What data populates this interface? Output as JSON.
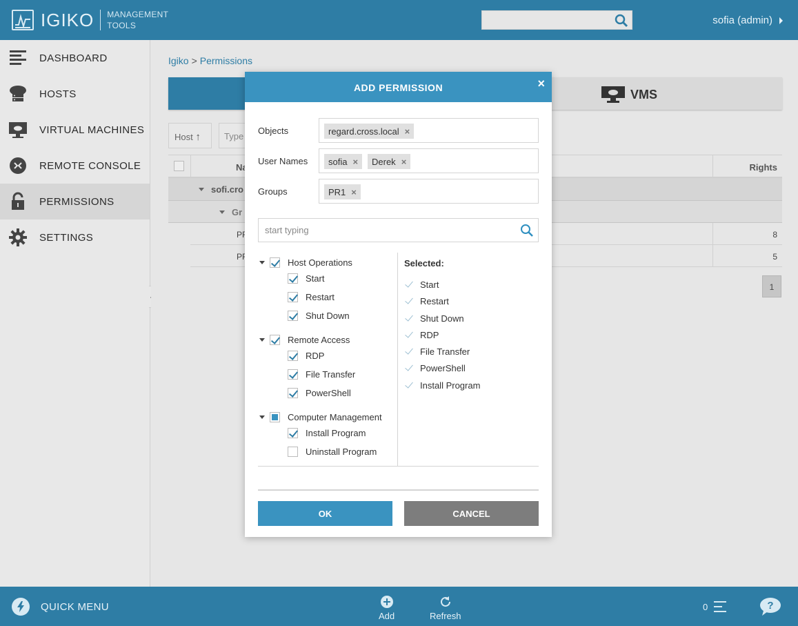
{
  "app": {
    "brand": "IGIKO",
    "subtitle_line1": "MANAGEMENT",
    "subtitle_line2": "TOOLS",
    "user": "sofia (admin)",
    "search_placeholder": ""
  },
  "sidebar": {
    "items": [
      {
        "label": "DASHBOARD",
        "icon": "dashboard-icon"
      },
      {
        "label": "HOSTS",
        "icon": "hosts-icon"
      },
      {
        "label": "VIRTUAL MACHINES",
        "icon": "vm-icon"
      },
      {
        "label": "REMOTE CONSOLE",
        "icon": "remote-console-icon"
      },
      {
        "label": "PERMISSIONS",
        "icon": "lock-icon",
        "active": true
      },
      {
        "label": "SETTINGS",
        "icon": "gear-icon"
      }
    ]
  },
  "main": {
    "breadcrumb": [
      "Igiko",
      "Permissions"
    ],
    "breadcrumb_sep": ">",
    "tabs": {
      "vms": "VMS"
    },
    "filters": {
      "host": "Host",
      "type": "Type"
    },
    "grid": {
      "col_name": "Na",
      "col_rights": "Rights",
      "group1": "sofi.cro",
      "group2": "Gr",
      "rows": [
        {
          "name": "PF",
          "rights": "8"
        },
        {
          "name": "PF",
          "rights": "5"
        }
      ]
    },
    "pager": "1"
  },
  "dialog": {
    "title": "ADD PERMISSION",
    "close": "×",
    "objects_label": "Objects",
    "objects": [
      "regard.cross.local"
    ],
    "usernames_label": "User Names",
    "usernames": [
      "sofia",
      "Derek"
    ],
    "groups_label": "Groups",
    "groups": [
      "PR1"
    ],
    "chip_remove": "×",
    "search_placeholder": "start typing",
    "tree": [
      {
        "label": "Host Operations",
        "state": "checked",
        "children": [
          {
            "label": "Start",
            "checked": true
          },
          {
            "label": "Restart",
            "checked": true
          },
          {
            "label": "Shut Down",
            "checked": true
          }
        ]
      },
      {
        "label": "Remote Access",
        "state": "checked",
        "children": [
          {
            "label": "RDP",
            "checked": true
          },
          {
            "label": "File Transfer",
            "checked": true
          },
          {
            "label": "PowerShell",
            "checked": true
          }
        ]
      },
      {
        "label": "Computer Management",
        "state": "partial",
        "children": [
          {
            "label": "Install Program",
            "checked": true
          },
          {
            "label": "Uninstall Program",
            "checked": false
          }
        ]
      }
    ],
    "selected_title": "Selected:",
    "selected": [
      "Start",
      "Restart",
      "Shut Down",
      "RDP",
      "File Transfer",
      "PowerShell",
      "Install Program"
    ],
    "ok": "OK",
    "cancel": "CANCEL"
  },
  "bottombar": {
    "quick_menu": "QUICK MENU",
    "add": "Add",
    "refresh": "Refresh",
    "count": "0"
  },
  "colors": {
    "primary": "#2e7da5",
    "dialog_header": "#3a93c0",
    "cancel": "#7d7d7d"
  }
}
